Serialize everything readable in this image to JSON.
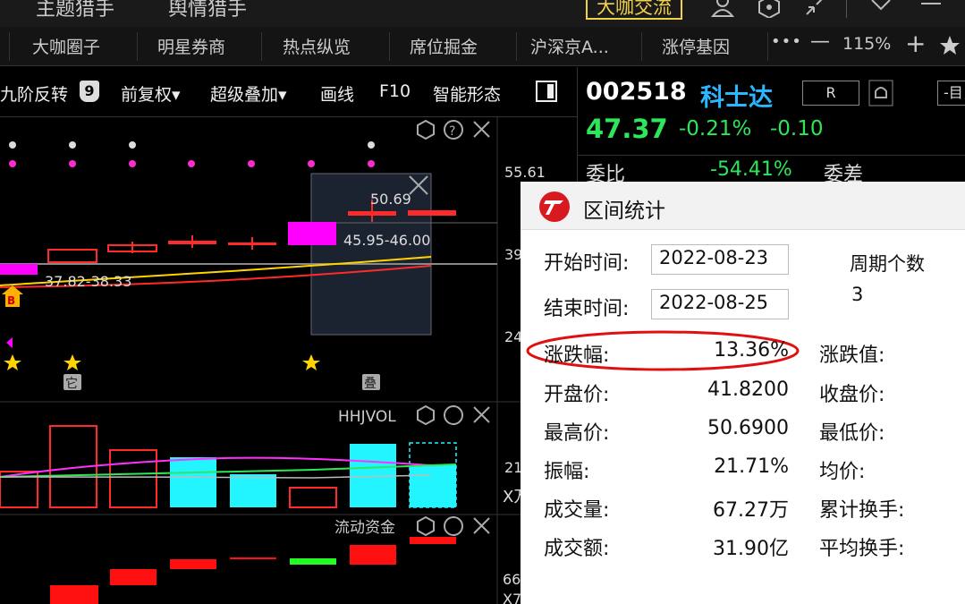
{
  "topbar": {
    "items": [
      "主题猎手",
      "舆情猎手"
    ],
    "highlight": "大咖交流"
  },
  "tabs": {
    "items": [
      "大咖圈子",
      "明星券商",
      "热点纵览",
      "席位掘金",
      "沪深京A...",
      "涨停基因"
    ],
    "more": "•••",
    "zoom_out": "—",
    "zoom": "115%",
    "zoom_in": "+"
  },
  "toolbar": {
    "items": [
      "九阶反转",
      "前复权▾",
      "超级叠加▾",
      "画线",
      "F10",
      "智能形态"
    ],
    "badge": "9"
  },
  "chart": {
    "price_ticks": [
      "55.61",
      "39",
      "24"
    ],
    "annot_high": "50.69",
    "annot_range": "45.95-46.00",
    "annot_low": "37.82-38.33",
    "b_marker": "B",
    "tag1": "它",
    "tag2": "叠",
    "vol_title": "HHJVOL",
    "vol_ticks": [
      "21",
      "X万"
    ],
    "flow_title": "流动资金",
    "flow_ticks": [
      "66",
      "X7"
    ]
  },
  "stock": {
    "code": "002518",
    "name": "科士达",
    "badge": "R",
    "price": "47.37",
    "change_pct": "-0.21%",
    "change": "-0.10",
    "weibi_label": "委比",
    "weibi_value": "-54.41%",
    "weicha_label": "委差",
    "right_btn": "-目"
  },
  "popup": {
    "title": "区间统计",
    "start_label": "开始时间:",
    "start_value": "2022-08-23",
    "end_label": "结束时间:",
    "end_value": "2022-08-25",
    "period_label": "周期个数",
    "period_value": "3",
    "rows": [
      {
        "label": "涨跌幅:",
        "value": "13.36%",
        "right": "涨跌值:"
      },
      {
        "label": "开盘价:",
        "value": "41.8200",
        "right": "收盘价:"
      },
      {
        "label": "最高价:",
        "value": "50.6900",
        "right": "最低价:"
      },
      {
        "label": "振幅:",
        "value": "21.71%",
        "right": "均价:"
      },
      {
        "label": "成交量:",
        "value": "67.27万",
        "right": "累计换手:"
      },
      {
        "label": "成交额:",
        "value": "31.90亿",
        "right": "平均换手:"
      }
    ]
  },
  "colors": {
    "up": "#ff2b2b",
    "down": "#00e5ff",
    "green": "#2ee65a",
    "magenta": "#ff00ff",
    "yellow": "#ffd400",
    "code_white": "#ffffff",
    "name_cyan": "#2ab7ff"
  }
}
